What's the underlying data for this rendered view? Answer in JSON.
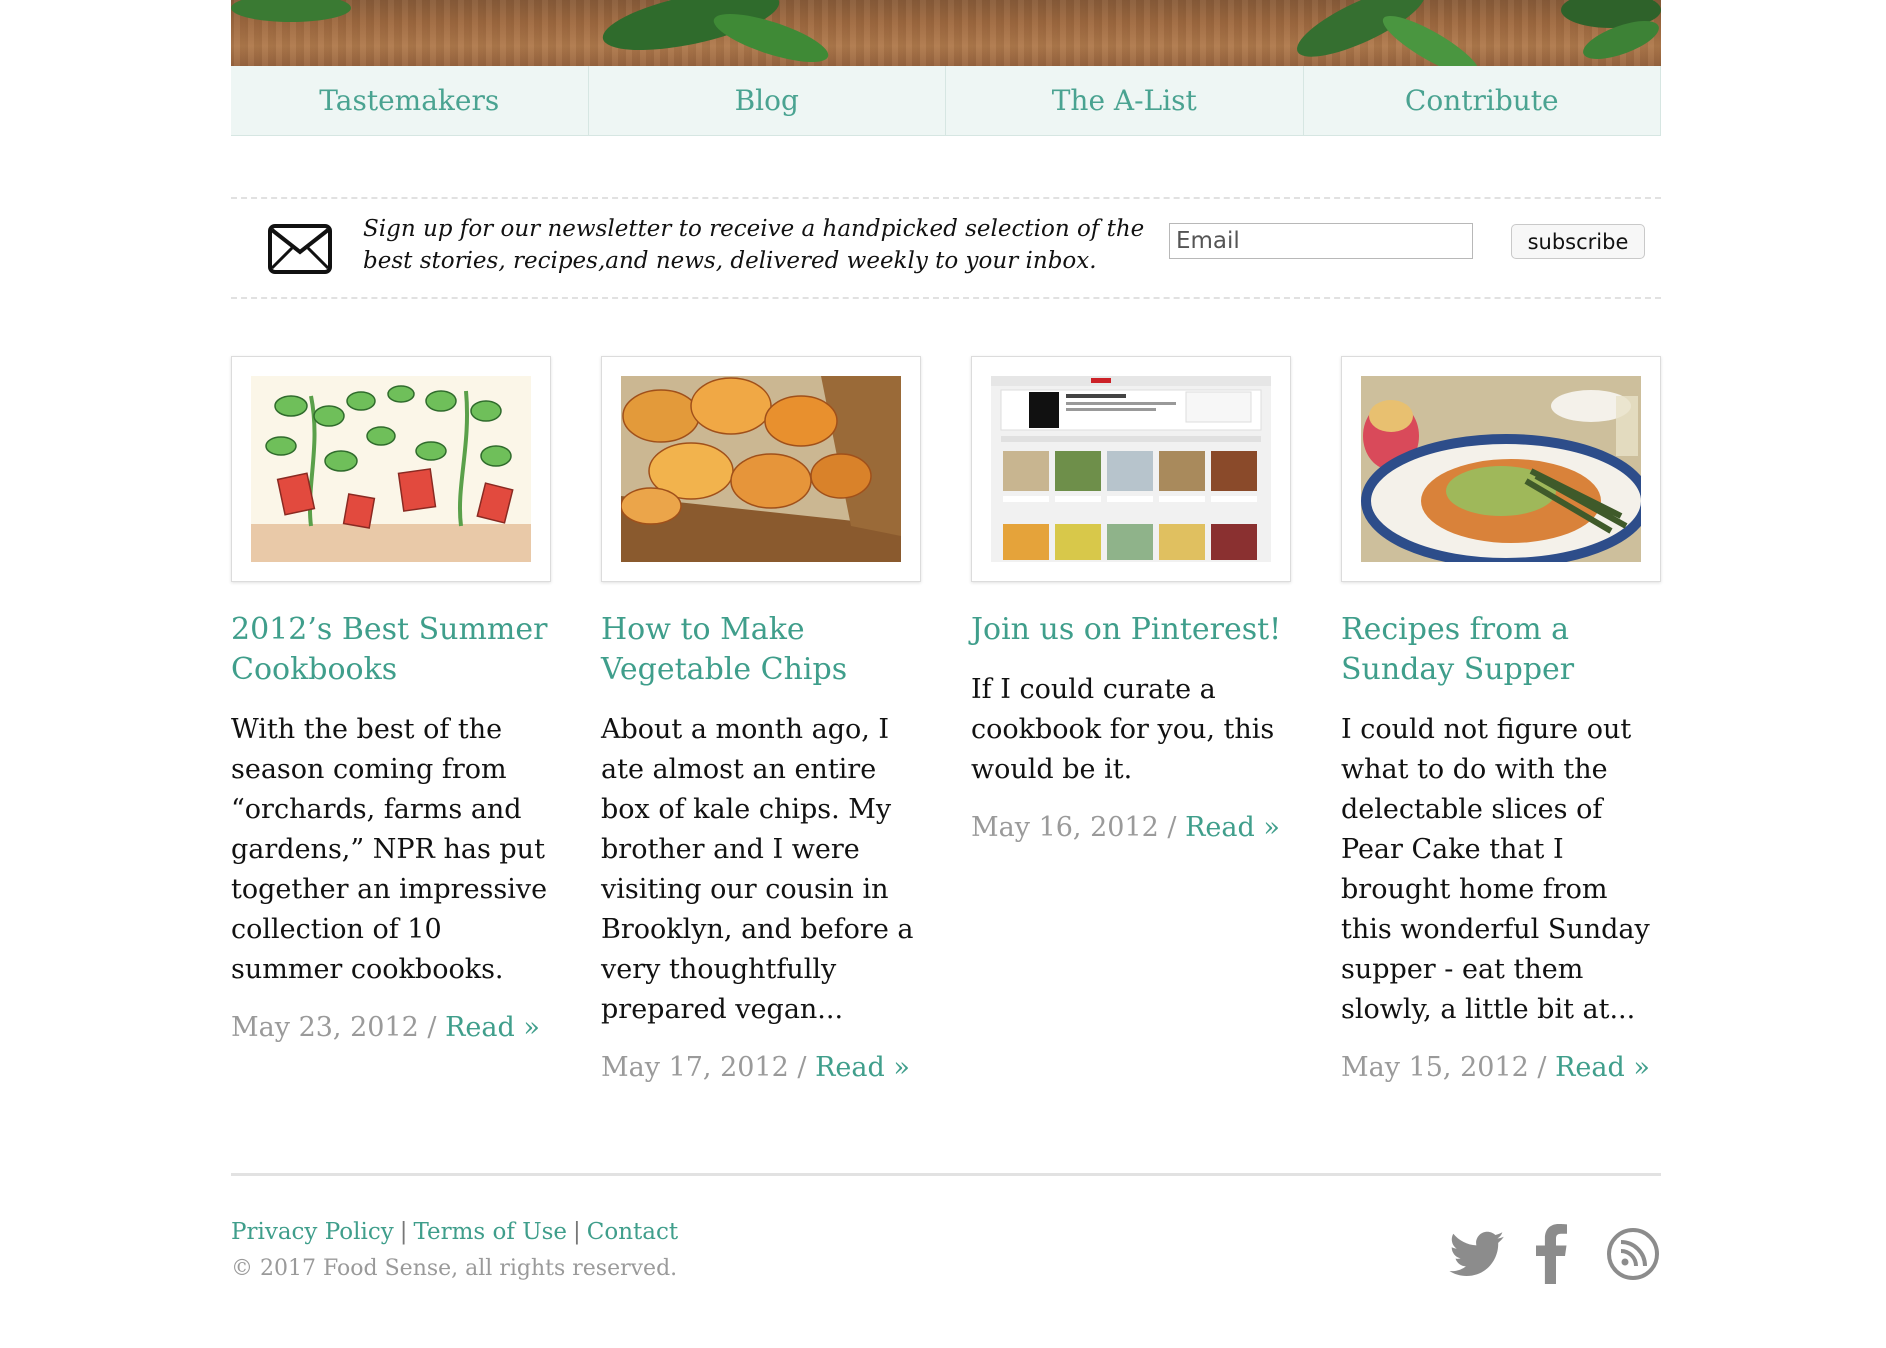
{
  "nav": {
    "items": [
      "Tastemakers",
      "Blog",
      "The A-List",
      "Contribute"
    ]
  },
  "newsletter": {
    "text": "Sign up for our newsletter to receive a handpicked selection of the best stories, recipes,and news, delivered weekly to your inbox.",
    "email_placeholder": "Email",
    "subscribe_label": "subscribe"
  },
  "articles": [
    {
      "title": "2012’s Best Summer Cookbooks",
      "excerpt": "With the best of the season coming from “orchards, farms and gardens,” NPR has put together an impressive collection of 10 summer cookbooks.",
      "date": "May 23, 2012",
      "read_label": "Read »"
    },
    {
      "title": "How to Make Vegetable Chips",
      "excerpt": "About a month ago, I ate almost an entire box of kale chips. My brother and I were visiting our cousin in Brooklyn, and before a very thoughtfully prepared vegan...",
      "date": "May 17, 2012",
      "read_label": "Read »"
    },
    {
      "title": "Join us on Pinterest!",
      "excerpt": "If I could curate a cookbook for you, this would be it.",
      "date": "May 16, 2012",
      "read_label": "Read »"
    },
    {
      "title": "Recipes from a Sunday Supper",
      "excerpt": "I could not figure out what to do with the delectable slices of Pear Cake that I brought home from this wonderful Sunday supper - eat them slowly, a little bit at...",
      "date": "May 15, 2012",
      "read_label": "Read »"
    }
  ],
  "footer": {
    "links": [
      "Privacy Policy",
      "Terms of Use",
      "Contact"
    ],
    "separator": "|",
    "copyright": "© 2017 Food Sense, all rights reserved.",
    "social_icons": [
      "twitter-icon",
      "facebook-icon",
      "rss-icon"
    ]
  },
  "colors": {
    "accent": "#3f9e8b",
    "nav_bg": "#eef6f4",
    "muted": "#9a9a9a"
  }
}
